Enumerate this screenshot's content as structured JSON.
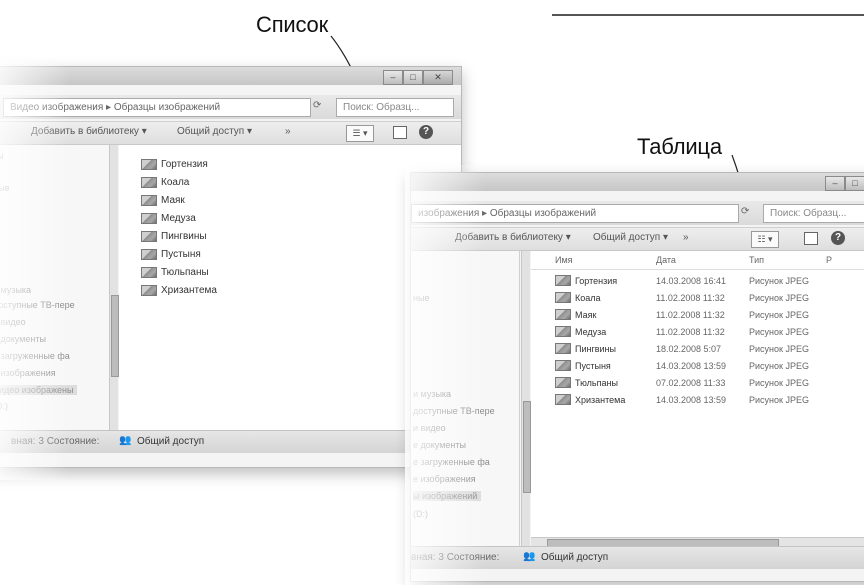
{
  "callouts": {
    "list_label": "Список",
    "table_label": "Таблица"
  },
  "window_list": {
    "breadcrumb": "Видео изображения ▸ Образцы изображений",
    "search_placeholder": "Поиск: Образц...",
    "toolbar": {
      "add_to_library": "Добавить в библиотеку ▾",
      "share": "Общий доступ ▾",
      "more": "»"
    },
    "nav_items": [
      "ты",
      "ные",
      "и музыка",
      "доступные ТВ-пере",
      "и видео",
      "е документы",
      "е загруженные фа",
      "е изображения",
      "Видео изображены",
      "(D:)"
    ],
    "files": [
      "Гортензия",
      "Коала",
      "Маяк",
      "Медуза",
      "Пингвины",
      "Пустыня",
      "Тюльпаны",
      "Хризантема"
    ],
    "status": {
      "text": "вная: 3 Состояние:",
      "share": "Общий доступ"
    }
  },
  "window_table": {
    "breadcrumb": "изображения ▸ Образцы изображений",
    "search_placeholder": "Поиск: Образц...",
    "toolbar": {
      "add_to_library": "Добавить в библиотеку ▾",
      "share": "Общий доступ ▾",
      "more": "»"
    },
    "nav_items": [
      "ные",
      "и музыка",
      "доступные ТВ-пере",
      "и видео",
      "е документы",
      "е загруженные фа",
      "е изображения",
      "ы изображений",
      "(D:)"
    ],
    "columns": [
      "Имя",
      "Дата",
      "Тип",
      "Р"
    ],
    "rows": [
      {
        "name": "Гортензия",
        "date": "14.03.2008 16:41",
        "type": "Рисунок JPEG"
      },
      {
        "name": "Коала",
        "date": "11.02.2008 11:32",
        "type": "Рисунок JPEG"
      },
      {
        "name": "Маяк",
        "date": "11.02.2008 11:32",
        "type": "Рисунок JPEG"
      },
      {
        "name": "Медуза",
        "date": "11.02.2008 11:32",
        "type": "Рисунок JPEG"
      },
      {
        "name": "Пингвины",
        "date": "18.02.2008 5:07",
        "type": "Рисунок JPEG"
      },
      {
        "name": "Пустыня",
        "date": "14.03.2008 13:59",
        "type": "Рисунок JPEG"
      },
      {
        "name": "Тюльпаны",
        "date": "07.02.2008 11:33",
        "type": "Рисунок JPEG"
      },
      {
        "name": "Хризантема",
        "date": "14.03.2008 13:59",
        "type": "Рисунок JPEG"
      }
    ],
    "status": {
      "text": "вная: 3 Состояние:",
      "share": "Общий доступ"
    }
  }
}
